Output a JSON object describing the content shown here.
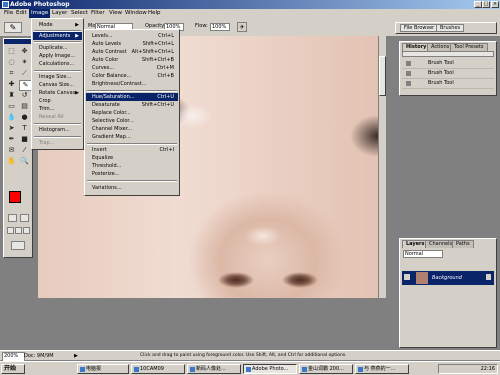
{
  "titlebar": {
    "title": "Adobe Photoshop",
    "min": "_",
    "max": "□",
    "close": "×"
  },
  "menubar": {
    "items": [
      "File",
      "Edit",
      "Image",
      "Layer",
      "Select",
      "Filter",
      "View",
      "Window",
      "Help"
    ],
    "active": "Image"
  },
  "options": {
    "mode_label": "Mode:",
    "mode_value": "Normal",
    "opacity_label": "Opacity:",
    "opacity_value": "100%",
    "flow_label": "Flow:",
    "flow_value": "100%"
  },
  "panel_well": {
    "file_browser": "File Browser",
    "brushes": "Brushes"
  },
  "image_menu": {
    "items": [
      {
        "label": "Mode",
        "arrow": "▶"
      },
      {
        "label": "Adjustments",
        "arrow": "▶",
        "highlighted": true
      },
      {
        "label": "Duplicate..."
      },
      {
        "label": "Apply Image..."
      },
      {
        "label": "Calculations..."
      },
      {
        "label": "Image Size..."
      },
      {
        "label": "Canvas Size..."
      },
      {
        "label": "Rotate Canvas",
        "arrow": "▶"
      },
      {
        "label": "Crop"
      },
      {
        "label": "Trim..."
      },
      {
        "label": "Reveal All",
        "disabled": true
      },
      {
        "label": "Histogram..."
      },
      {
        "label": "Trap...",
        "disabled": true
      }
    ]
  },
  "adjustments_menu": {
    "items": [
      {
        "label": "Levels...",
        "shortcut": "Ctrl+L"
      },
      {
        "label": "Auto Levels",
        "shortcut": "Shift+Ctrl+L"
      },
      {
        "label": "Auto Contrast",
        "shortcut": "Alt+Shift+Ctrl+L"
      },
      {
        "label": "Auto Color",
        "shortcut": "Shift+Ctrl+B"
      },
      {
        "label": "Curves...",
        "shortcut": "Ctrl+M"
      },
      {
        "label": "Color Balance...",
        "shortcut": "Ctrl+B"
      },
      {
        "label": "Brightness/Contrast..."
      },
      {
        "label": "Hue/Saturation...",
        "shortcut": "Ctrl+U",
        "highlighted": true
      },
      {
        "label": "Desaturate",
        "shortcut": "Shift+Ctrl+U"
      },
      {
        "label": "Replace Color..."
      },
      {
        "label": "Selective Color..."
      },
      {
        "label": "Channel Mixer..."
      },
      {
        "label": "Gradient Map..."
      },
      {
        "label": "Invert",
        "shortcut": "Ctrl+I"
      },
      {
        "label": "Equalize"
      },
      {
        "label": "Threshold..."
      },
      {
        "label": "Posterize..."
      },
      {
        "label": "Variations..."
      }
    ]
  },
  "history": {
    "tabs": [
      "History",
      "Actions",
      "Tool Presets"
    ],
    "rows": [
      "Brush Tool",
      "Brush Tool",
      "Brush Tool"
    ]
  },
  "layers": {
    "tabs": [
      "Layers",
      "Channels",
      "Paths"
    ],
    "blend": "Normal",
    "layer_name": "Background"
  },
  "status": {
    "zoom": "200%",
    "doc": "Doc: 9M/9M",
    "hint": "Click and drag to paint using foreground color. Use Shift, Alt, and Ctrl for additional options."
  },
  "taskbar": {
    "start": "开始",
    "tasks": [
      "电脑报",
      "10CAM09",
      "新码人像处...",
      "Adobe Photo...",
      "金山词霸 200...",
      "与 燕燕的一..."
    ],
    "active_task": 3,
    "clock": "22:16"
  },
  "colors": {
    "foreground": "#ff0000",
    "background": "#ffffff",
    "menu_highlight": "#0a246a"
  }
}
